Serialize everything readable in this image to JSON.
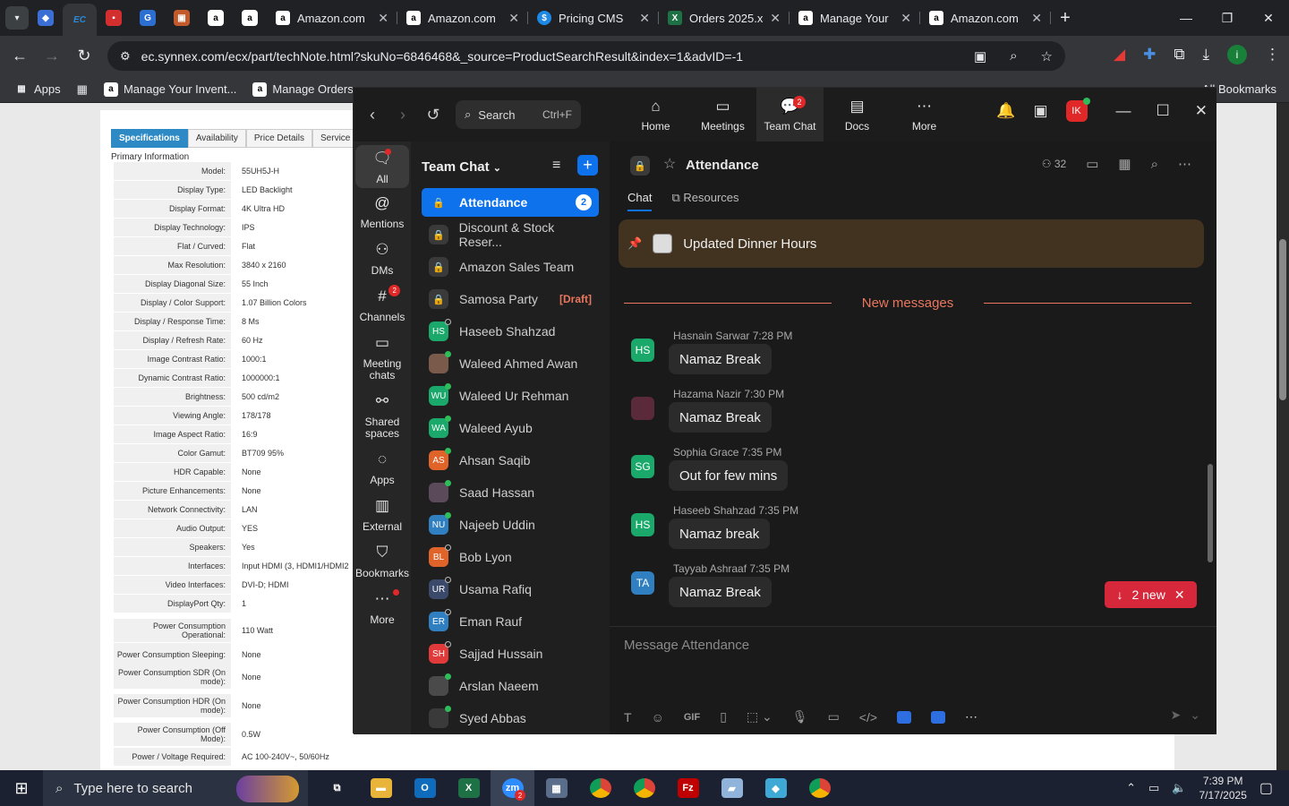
{
  "browser": {
    "tabs": [
      {
        "label": "Amazon.com",
        "icon": "amazon-icon"
      },
      {
        "label": "Amazon.com",
        "icon": "amazon-icon"
      },
      {
        "label": "Pricing CMS",
        "icon": "dollar-icon"
      },
      {
        "label": "Orders 2025.x",
        "icon": "excel-icon"
      },
      {
        "label": "Manage Your",
        "icon": "amazon-icon"
      },
      {
        "label": "Amazon.com",
        "icon": "amazon-icon"
      }
    ],
    "url": "ec.synnex.com/ecx/part/techNote.html?skuNo=6846468&_source=ProductSearchResult&index=1&advID=-1",
    "bookmarks": [
      {
        "label": "Apps"
      },
      {
        "label": "Manage Your Invent..."
      },
      {
        "label": "Manage Orders"
      }
    ],
    "all_bookmarks": "All Bookmarks"
  },
  "spec_page": {
    "tabs": [
      "Specifications",
      "Availability",
      "Price Details",
      "Service &"
    ],
    "section": "Primary Information",
    "rows": [
      {
        "k": "Model:",
        "v": "55UH5J-H"
      },
      {
        "k": "Display Type:",
        "v": "LED Backlight"
      },
      {
        "k": "Display Format:",
        "v": "4K Ultra HD"
      },
      {
        "k": "Display Technology:",
        "v": "IPS"
      },
      {
        "k": "Flat / Curved:",
        "v": "Flat"
      },
      {
        "k": "Max Resolution:",
        "v": "3840 x 2160"
      },
      {
        "k": "Display Diagonal Size:",
        "v": "55 Inch"
      },
      {
        "k": "Display / Color Support:",
        "v": "1.07 Billion Colors"
      },
      {
        "k": "Display / Response Time:",
        "v": "8 Ms"
      },
      {
        "k": "Display / Refresh Rate:",
        "v": "60 Hz"
      },
      {
        "k": "Image Contrast Ratio:",
        "v": "1000:1"
      },
      {
        "k": "Dynamic Contrast Ratio:",
        "v": "1000000:1"
      },
      {
        "k": "Brightness:",
        "v": "500 cd/m2"
      },
      {
        "k": "Viewing Angle:",
        "v": "178/178"
      },
      {
        "k": "Image Aspect Ratio:",
        "v": "16:9"
      },
      {
        "k": "Color Gamut:",
        "v": "BT709 95%"
      },
      {
        "k": "HDR Capable:",
        "v": "None"
      },
      {
        "k": "Picture Enhancements:",
        "v": "None"
      },
      {
        "k": "Network Connectivity:",
        "v": "LAN"
      },
      {
        "k": "Audio Output:",
        "v": "YES"
      },
      {
        "k": "Speakers:",
        "v": "Yes"
      },
      {
        "k": "Interfaces:",
        "v": "Input HDMI (3, HDMI1/HDMI2"
      },
      {
        "k": "Video Interfaces:",
        "v": "DVI-D; HDMI"
      },
      {
        "k": "DisplayPort Qty:",
        "v": "1"
      },
      {
        "k": "Power Consumption Operational:",
        "v": "110 Watt"
      },
      {
        "k": "Power Consumption Sleeping:",
        "v": "None"
      },
      {
        "k": "Power Consumption SDR (On mode):",
        "v": "None"
      },
      {
        "k": "Power Consumption HDR (On mode):",
        "v": "None"
      },
      {
        "k": "Power Consumption (Off Mode):",
        "v": "0.5W"
      },
      {
        "k": "Power / Voltage Required:",
        "v": "AC 100-240V~, 50/60Hz"
      }
    ]
  },
  "zoom": {
    "search": {
      "label": "Search",
      "shortcut": "Ctrl+F"
    },
    "nav_tabs": [
      {
        "label": "Home",
        "icon": "home-icon"
      },
      {
        "label": "Meetings",
        "icon": "video-icon"
      },
      {
        "label": "Team Chat",
        "icon": "chat-icon",
        "badge": "2"
      },
      {
        "label": "Docs",
        "icon": "doc-icon"
      },
      {
        "label": "More",
        "icon": "more-icon"
      }
    ],
    "user_initials": "IK",
    "rail": [
      {
        "label": "All",
        "icon": "chat-bubble-icon"
      },
      {
        "label": "Mentions",
        "icon": "at-icon"
      },
      {
        "label": "DMs",
        "icon": "people-icon"
      },
      {
        "label": "Channels",
        "icon": "hash-icon",
        "badge": "2"
      },
      {
        "label": "Meeting chats",
        "icon": "calendar-icon"
      },
      {
        "label": "Shared spaces",
        "icon": "share-icon"
      },
      {
        "label": "Apps",
        "icon": "apps-icon"
      },
      {
        "label": "External",
        "icon": "building-icon"
      },
      {
        "label": "Bookmarks",
        "icon": "bookmark-icon"
      },
      {
        "label": "More",
        "icon": "more-icon"
      }
    ],
    "list_title": "Team Chat",
    "channels": [
      {
        "name": "Attendance",
        "count": "2"
      },
      {
        "name": "Discount & Stock Reser..."
      },
      {
        "name": "Amazon Sales Team"
      },
      {
        "name": "Samosa Party",
        "draft": "[Draft]"
      }
    ],
    "contacts": [
      {
        "name": "Haseeb Shahzad",
        "initials": "HS",
        "color": "#1aa86b",
        "status": "away"
      },
      {
        "name": "Waleed Ahmed Awan",
        "initials": "",
        "color": "#7a5a4a",
        "status": "online"
      },
      {
        "name": "Waleed Ur Rehman",
        "initials": "WU",
        "color": "#1aa86b",
        "status": "online"
      },
      {
        "name": "Waleed Ayub",
        "initials": "WA",
        "color": "#1aa86b",
        "status": "online"
      },
      {
        "name": "Ahsan Saqib",
        "initials": "AS",
        "color": "#e0642a",
        "status": "online"
      },
      {
        "name": "Saad Hassan",
        "initials": "",
        "color": "#5a4a5a",
        "status": "online"
      },
      {
        "name": "Najeeb Uddin",
        "initials": "NU",
        "color": "#2f7fc1",
        "status": "online"
      },
      {
        "name": "Bob Lyon",
        "initials": "BL",
        "color": "#e0642a",
        "status": "away"
      },
      {
        "name": "Usama Rafiq",
        "initials": "UR",
        "color": "#3b4a6a",
        "status": "away"
      },
      {
        "name": "Eman Rauf",
        "initials": "ER",
        "color": "#2f7fc1",
        "status": "away"
      },
      {
        "name": "Sajjad Hussain",
        "initials": "SH",
        "color": "#e03a3a",
        "status": "away"
      },
      {
        "name": "Arslan Naeem",
        "initials": "",
        "color": "#4a4a4a",
        "status": "online"
      },
      {
        "name": "Syed Abbas",
        "initials": "",
        "color": "#3a3a3a",
        "status": "online"
      }
    ],
    "channel": {
      "name": "Attendance",
      "members": "32",
      "tabs": [
        "Chat",
        "Resources"
      ],
      "pinned": "Updated Dinner Hours",
      "new_messages": "New messages",
      "messages": [
        {
          "author": "Hasnain Sarwar",
          "time": "7:28 PM",
          "text": "Namaz Break",
          "initials": "HS",
          "color": "#1aa86b"
        },
        {
          "author": "Hazama Nazir",
          "time": "7:30 PM",
          "text": "Namaz Break",
          "initials": "",
          "color": "#5a2a3a"
        },
        {
          "author": "Sophia Grace",
          "time": "7:35 PM",
          "text": "Out for few mins",
          "initials": "SG",
          "color": "#1aa86b"
        },
        {
          "author": "Haseeb Shahzad",
          "time": "7:35 PM",
          "text": "Namaz break",
          "initials": "HS",
          "color": "#1aa86b"
        },
        {
          "author": "Tayyab Ashraaf",
          "time": "7:35 PM",
          "text": "Namaz Break",
          "initials": "TA",
          "color": "#2f7fc1"
        }
      ],
      "new_count": "2 new",
      "composer_placeholder": "Message Attendance"
    }
  },
  "taskbar": {
    "search_placeholder": "Type here to search",
    "time": "7:39 PM",
    "date": "7/17/2025",
    "zoom_badge": "2"
  }
}
